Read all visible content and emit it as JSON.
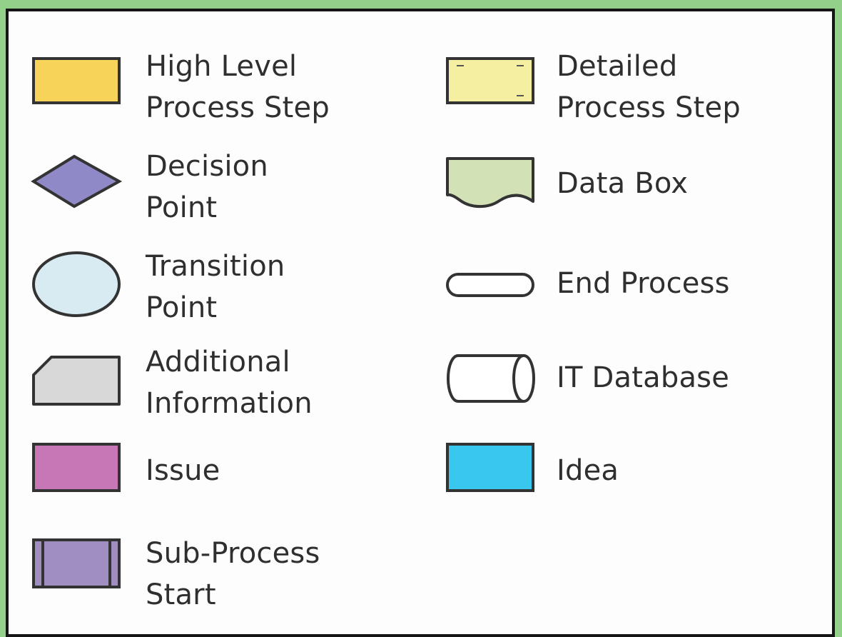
{
  "colors": {
    "background": "#93d08a",
    "panel": "#fdfdfd",
    "border": "#151515",
    "text": "#2f2f2f"
  },
  "legend": {
    "items": [
      {
        "name": "high-level-process-step",
        "icon": "rectangle-icon",
        "color": "#f7d35a",
        "label": "High Level\nProcess Step"
      },
      {
        "name": "detailed-process-step",
        "icon": "document-rectangle-icon",
        "color": "#f5f0a1",
        "label": "Detailed\nProcess Step"
      },
      {
        "name": "decision-point",
        "icon": "diamond-icon",
        "color": "#8f89c8",
        "label": "Decision\nPoint"
      },
      {
        "name": "data-box",
        "icon": "wavy-document-icon",
        "color": "#d2e1b6",
        "label": "Data Box"
      },
      {
        "name": "transition-point",
        "icon": "circle-icon",
        "color": "#d8eaf2",
        "label": "Transition\nPoint"
      },
      {
        "name": "end-process",
        "icon": "terminator-icon",
        "color": "#ffffff",
        "label": "End Process"
      },
      {
        "name": "additional-information",
        "icon": "cut-corner-rectangle-icon",
        "color": "#d8d8d8",
        "label": "Additional\nInformation"
      },
      {
        "name": "it-database",
        "icon": "cylinder-icon",
        "color": "#ffffff",
        "label": "IT Database"
      },
      {
        "name": "issue",
        "icon": "rectangle-icon",
        "color": "#c776b6",
        "label": "Issue"
      },
      {
        "name": "idea",
        "icon": "rectangle-icon",
        "color": "#39c6ef",
        "label": "Idea"
      },
      {
        "name": "sub-process-start",
        "icon": "subprocess-icon",
        "color": "#a18ec0",
        "label": "Sub-Process\nStart"
      }
    ]
  }
}
